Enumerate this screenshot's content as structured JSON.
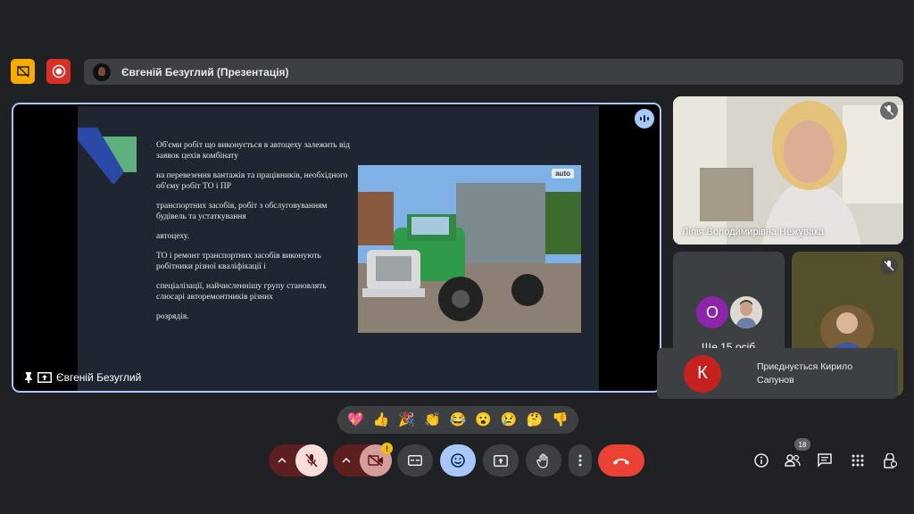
{
  "header": {
    "presentation_title": "Євгеній Безуглий (Презентація)"
  },
  "main": {
    "presenter_label": "Євгеній Безуглий",
    "slide": {
      "paragraphs": [
        "Об'єми робіт що виконується в автоцеху залежить від заявок цехів комбінату",
        "на перевезення вантажів та працівників, необхідного об'єму робіт ТО і ПР",
        "транспортних засобів, робіт з обслуговуванням будівель та устаткування",
        "автоцеху.",
        "ТО і ремонт транспортних засобів виконують робітники різної кваліфікації і",
        "спеціалізації, найчисленнішу групу становлять слюсарі авторемонтників різних",
        "розрядів."
      ],
      "photo_badge": "auto"
    }
  },
  "participants": {
    "lilia_name": "Лілія Володимирівна Нежувака",
    "more_avatar_letter": "О",
    "more_text": "Ще 15 осіб"
  },
  "toast": {
    "avatar_letter": "К",
    "text": "Приєднується Кирило Сапунов"
  },
  "reactions": [
    "💖",
    "👍",
    "🎉",
    "👏",
    "😂",
    "😮",
    "😢",
    "🤔",
    "👎"
  ],
  "controls": {
    "camera_warning": "!",
    "participants_count": "18"
  },
  "colors": {
    "accent": "#a8c7fa",
    "muted_red": "#f9dedc",
    "leave_red": "#ea4335",
    "record_red": "#d93025",
    "warning_yellow": "#f9ab00"
  }
}
